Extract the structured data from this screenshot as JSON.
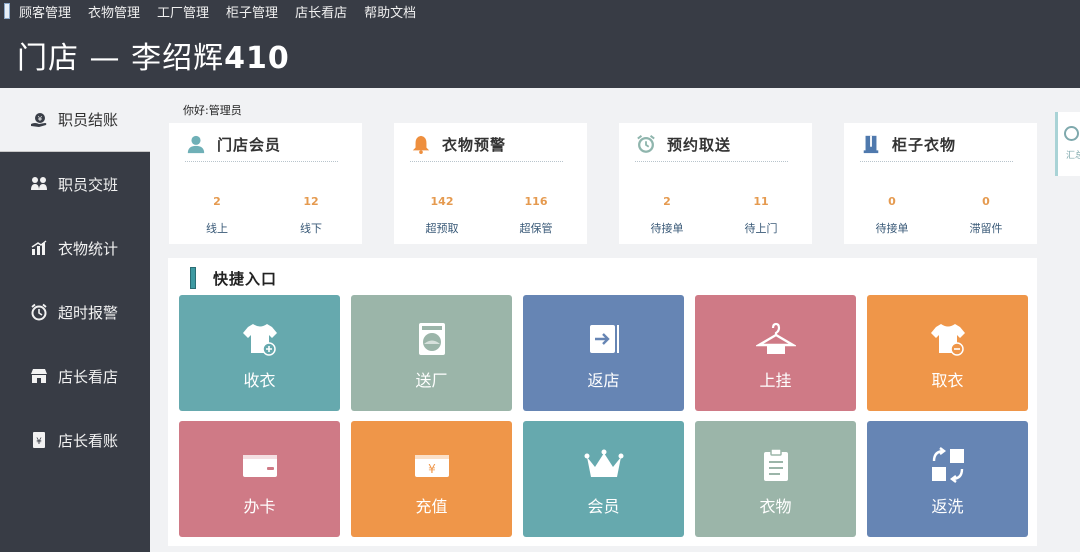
{
  "menubar": {
    "items": [
      "顾客管理",
      "衣物管理",
      "工厂管理",
      "柜子管理",
      "店长看店",
      "帮助文档"
    ]
  },
  "header": {
    "title_prefix": "门店 — 李绍辉",
    "title_number": "410"
  },
  "sidebar": {
    "items": [
      {
        "label": "职员结账",
        "icon": "yen-hand-icon",
        "active": true
      },
      {
        "label": "职员交班",
        "icon": "handover-icon",
        "active": false
      },
      {
        "label": "衣物统计",
        "icon": "bar-chart-icon",
        "active": false
      },
      {
        "label": "超时报警",
        "icon": "alarm-clock-icon",
        "active": false
      },
      {
        "label": "店长看店",
        "icon": "storefront-icon",
        "active": false
      },
      {
        "label": "店长看账",
        "icon": "ledger-yen-icon",
        "active": false
      }
    ]
  },
  "greeting": "你好:管理员",
  "cards": [
    {
      "title": "门店会员",
      "icon": "person-icon",
      "icon_color": "#6fb0b7",
      "stats": [
        {
          "value": "2",
          "label": "线上"
        },
        {
          "value": "12",
          "label": "线下"
        }
      ]
    },
    {
      "title": "衣物预警",
      "icon": "bell-icon",
      "icon_color": "#ee8f3e",
      "stats": [
        {
          "value": "142",
          "label": "超预取"
        },
        {
          "value": "116",
          "label": "超保管"
        }
      ]
    },
    {
      "title": "预约取送",
      "icon": "alarm-clock-icon",
      "icon_color": "#8fb5ad",
      "stats": [
        {
          "value": "2",
          "label": "待接单"
        },
        {
          "value": "11",
          "label": "待上门"
        }
      ]
    },
    {
      "title": "柜子衣物",
      "icon": "locker-icon",
      "icon_color": "#4f79ad",
      "stats": [
        {
          "value": "0",
          "label": "待接单"
        },
        {
          "value": "0",
          "label": "滞留件"
        }
      ]
    }
  ],
  "quick": {
    "title": "快捷入口",
    "tiles": [
      {
        "label": "收衣",
        "icon": "shirt-plus-icon",
        "color": "#66a9ae"
      },
      {
        "label": "送厂",
        "icon": "washing-machine-icon",
        "color": "#9bb5a9"
      },
      {
        "label": "返店",
        "icon": "return-arrow-icon",
        "color": "#6685b4"
      },
      {
        "label": "上挂",
        "icon": "hanger-icon",
        "color": "#cf7a86"
      },
      {
        "label": "取衣",
        "icon": "shirt-minus-icon",
        "color": "#ef9649"
      },
      {
        "label": "办卡",
        "icon": "wallet-card-icon",
        "color": "#cf7a86"
      },
      {
        "label": "充值",
        "icon": "yen-card-icon",
        "color": "#ef9649"
      },
      {
        "label": "会员",
        "icon": "crown-icon",
        "color": "#66a9ae"
      },
      {
        "label": "衣物",
        "icon": "clipboard-icon",
        "color": "#9bb5a9"
      },
      {
        "label": "返洗",
        "icon": "rewash-icon",
        "color": "#6685b4"
      }
    ]
  },
  "side_tab": {
    "label": "汇总"
  }
}
